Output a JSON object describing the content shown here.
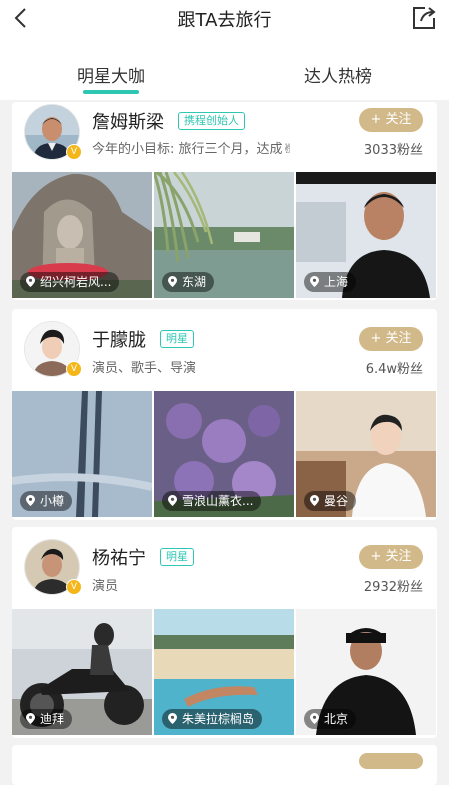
{
  "header": {
    "title": "跟TA去旅行"
  },
  "tabs": [
    {
      "label": "明星大咖"
    },
    {
      "label": "达人热榜"
    }
  ],
  "cards": [
    {
      "name": "詹姆斯梁",
      "tag": "携程创始人",
      "subtitle": "今年的小目标: 旅行三个月，达成✌",
      "follow": "+ 关注",
      "fans": "3033粉丝",
      "locations": [
        "绍兴柯岩风...",
        "东湖",
        "上海"
      ]
    },
    {
      "name": "于朦胧",
      "tag": "明星",
      "subtitle": "演员、歌手、导演",
      "follow": "+ 关注",
      "fans": "6.4w粉丝",
      "locations": [
        "小樽",
        "雪浪山薰衣...",
        "曼谷"
      ]
    },
    {
      "name": "杨祐宁",
      "tag": "明星",
      "subtitle": "演员",
      "follow": "+ 关注",
      "fans": "2932粉丝",
      "locations": [
        "迪拜",
        "朱美拉棕榈岛",
        "北京"
      ]
    }
  ],
  "icons": {
    "back": "chevron-left-icon",
    "share": "share-icon",
    "pin": "location-pin-icon",
    "verified": "verified-badge-icon"
  }
}
